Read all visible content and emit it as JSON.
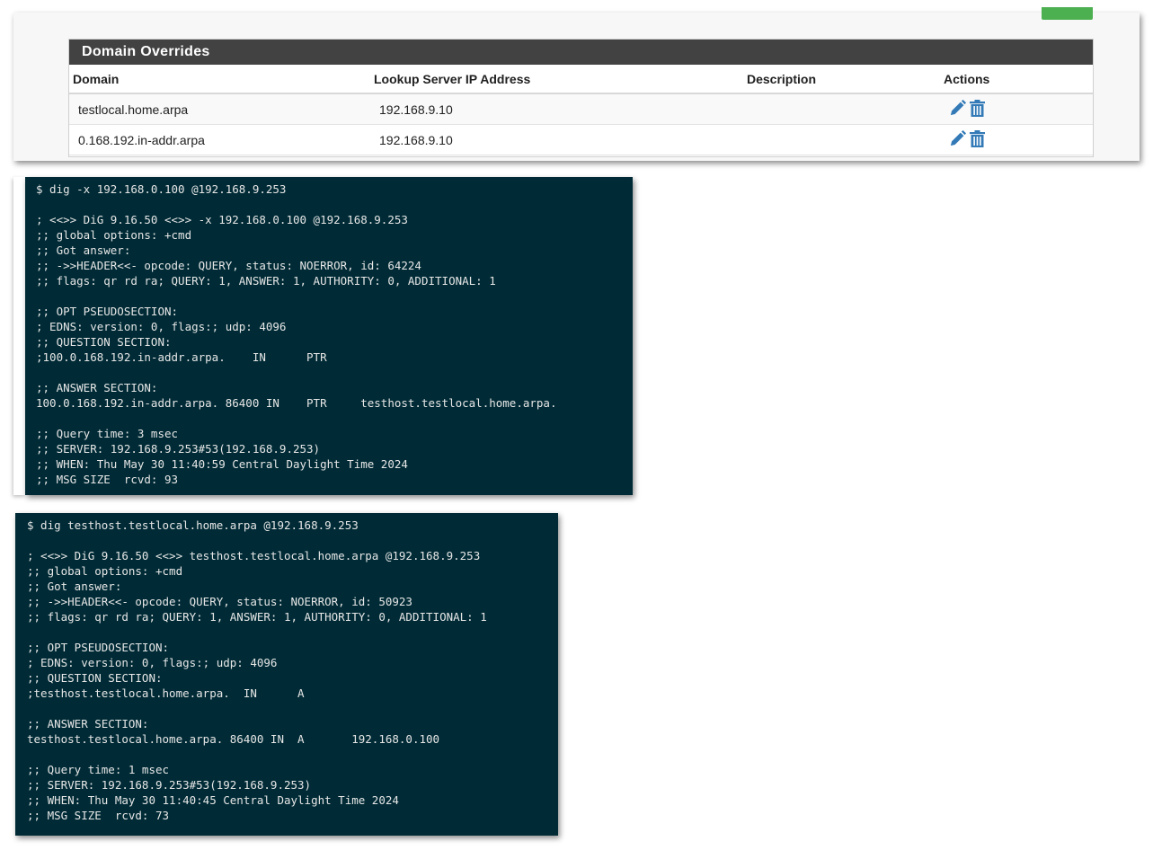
{
  "overrides_panel": {
    "title": "Domain Overrides",
    "columns": {
      "domain": "Domain",
      "ip": "Lookup Server IP Address",
      "description": "Description",
      "actions": "Actions"
    },
    "rows": [
      {
        "domain": "testlocal.home.arpa",
        "ip": "192.168.9.10",
        "description": ""
      },
      {
        "domain": "0.168.192.in-addr.arpa",
        "ip": "192.168.9.10",
        "description": ""
      }
    ],
    "icons": {
      "edit": "pencil-icon",
      "delete": "trash-icon"
    },
    "accent_color": "#337ab7",
    "heading_color": "#424242",
    "button_color": "#4caf50"
  },
  "terminal1": {
    "background": "#002b36",
    "lines": [
      "$ dig -x 192.168.0.100 @192.168.9.253",
      "",
      "; <<>> DiG 9.16.50 <<>> -x 192.168.0.100 @192.168.9.253",
      ";; global options: +cmd",
      ";; Got answer:",
      ";; ->>HEADER<<- opcode: QUERY, status: NOERROR, id: 64224",
      ";; flags: qr rd ra; QUERY: 1, ANSWER: 1, AUTHORITY: 0, ADDITIONAL: 1",
      "",
      ";; OPT PSEUDOSECTION:",
      "; EDNS: version: 0, flags:; udp: 4096",
      ";; QUESTION SECTION:",
      ";100.0.168.192.in-addr.arpa.    IN      PTR",
      "",
      ";; ANSWER SECTION:",
      "100.0.168.192.in-addr.arpa. 86400 IN    PTR     testhost.testlocal.home.arpa.",
      "",
      ";; Query time: 3 msec",
      ";; SERVER: 192.168.9.253#53(192.168.9.253)",
      ";; WHEN: Thu May 30 11:40:59 Central Daylight Time 2024",
      ";; MSG SIZE  rcvd: 93"
    ]
  },
  "terminal2": {
    "background": "#002b36",
    "lines": [
      "$ dig testhost.testlocal.home.arpa @192.168.9.253",
      "",
      "; <<>> DiG 9.16.50 <<>> testhost.testlocal.home.arpa @192.168.9.253",
      ";; global options: +cmd",
      ";; Got answer:",
      ";; ->>HEADER<<- opcode: QUERY, status: NOERROR, id: 50923",
      ";; flags: qr rd ra; QUERY: 1, ANSWER: 1, AUTHORITY: 0, ADDITIONAL: 1",
      "",
      ";; OPT PSEUDOSECTION:",
      "; EDNS: version: 0, flags:; udp: 4096",
      ";; QUESTION SECTION:",
      ";testhost.testlocal.home.arpa.  IN      A",
      "",
      ";; ANSWER SECTION:",
      "testhost.testlocal.home.arpa. 86400 IN  A       192.168.0.100",
      "",
      ";; Query time: 1 msec",
      ";; SERVER: 192.168.9.253#53(192.168.9.253)",
      ";; WHEN: Thu May 30 11:40:45 Central Daylight Time 2024",
      ";; MSG SIZE  rcvd: 73"
    ]
  }
}
